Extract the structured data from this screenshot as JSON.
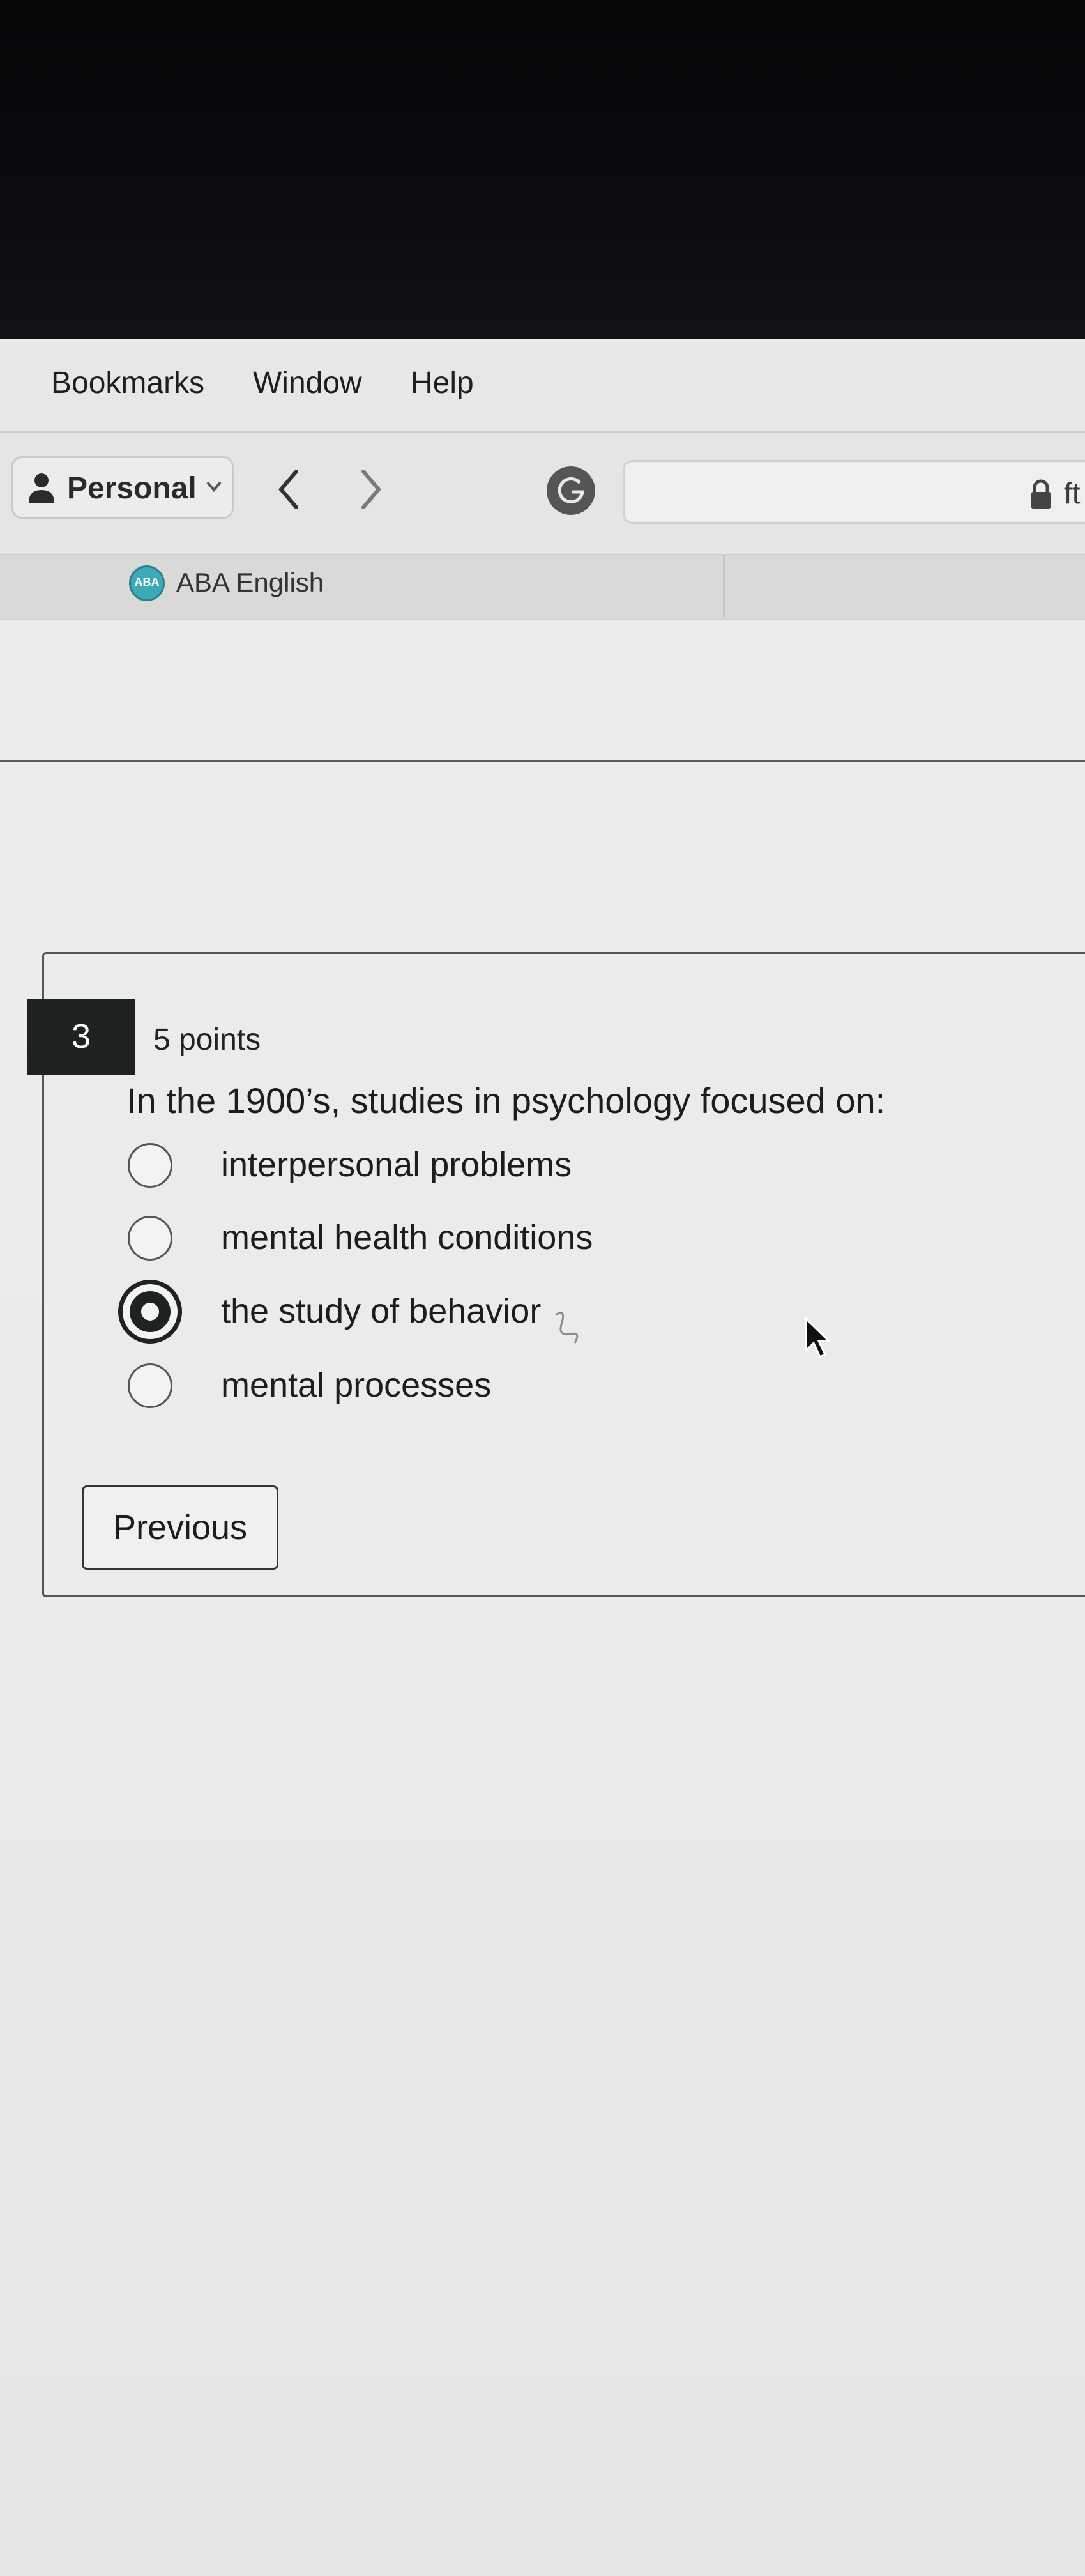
{
  "menubar": {
    "items": [
      "Bookmarks",
      "Window",
      "Help"
    ]
  },
  "toolbar": {
    "profile_label": "Personal",
    "profile_icon": "person-icon",
    "back_icon": "chevron-left-icon",
    "forward_icon": "chevron-right-icon",
    "extension_icon": "grammarly-icon",
    "lock_icon": "lock-icon",
    "url_fragment": "ft"
  },
  "bookmarks": {
    "items": [
      {
        "label": "ABA English",
        "icon_text": "ABA"
      }
    ]
  },
  "quiz": {
    "question_number": "3",
    "points": "5 points",
    "question": "In the 1900’s, studies in psychology focused on:",
    "options": [
      {
        "label": "interpersonal problems",
        "selected": false
      },
      {
        "label": "mental health conditions",
        "selected": false
      },
      {
        "label": "the study of behavior",
        "selected": true
      },
      {
        "label": "mental processes",
        "selected": false
      }
    ],
    "previous_label": "Previous"
  },
  "colors": {
    "accent_dark": "#1f2223",
    "page_bg": "#ebebe9"
  }
}
